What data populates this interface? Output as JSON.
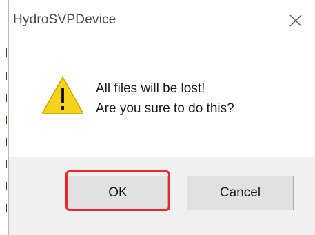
{
  "window": {
    "title": "HydroSVPDevice",
    "close_icon": "close-icon"
  },
  "message": {
    "icon": "warning-icon",
    "line1": "All files will be lost!",
    "line2": "Are you sure to do this?"
  },
  "buttons": {
    "ok_label": "OK",
    "cancel_label": "Cancel"
  },
  "colors": {
    "highlight": "#e8262b",
    "warning_fill": "#f8d21a",
    "footer_bg": "#f0f0f0"
  }
}
